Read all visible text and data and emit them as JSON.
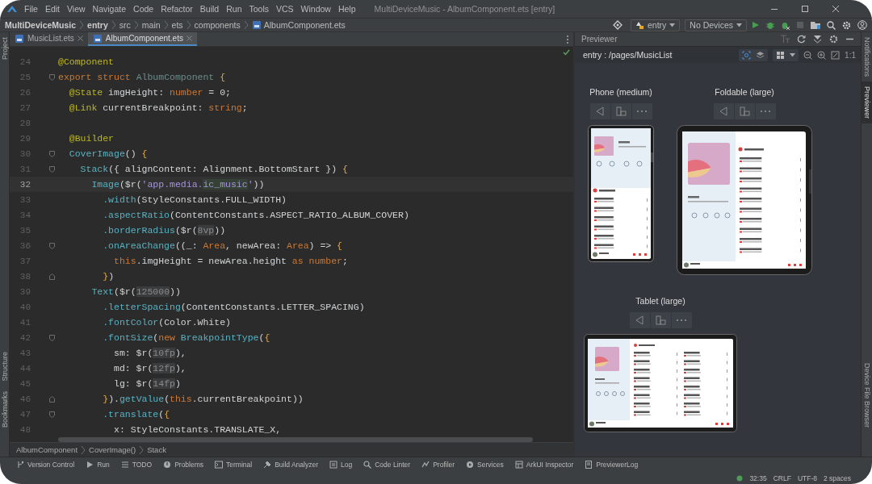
{
  "menu": [
    "File",
    "Edit",
    "View",
    "Navigate",
    "Code",
    "Refactor",
    "Build",
    "Run",
    "Tools",
    "VCS",
    "Window",
    "Help"
  ],
  "window_title": "MultiDeviceMusic - AlbumComponent.ets [entry]",
  "breadcrumbs": [
    {
      "label": "MultiDeviceMusic",
      "kind": "project"
    },
    {
      "label": "entry",
      "kind": "module"
    },
    {
      "label": "src",
      "kind": "folder"
    },
    {
      "label": "main",
      "kind": "folder"
    },
    {
      "label": "ets",
      "kind": "folder"
    },
    {
      "label": "components",
      "kind": "folder"
    },
    {
      "label": "AlbumComponent.ets",
      "kind": "file"
    }
  ],
  "run_config": "entry",
  "device_selector": "No Devices",
  "left_tool_tabs": {
    "top": [
      {
        "label": "Project"
      }
    ],
    "bottom": [
      {
        "label": "Structure"
      },
      {
        "label": "Bookmarks"
      }
    ]
  },
  "right_tool_tabs": {
    "top": [
      {
        "label": "Notifications",
        "selected": false
      },
      {
        "label": "Previewer",
        "selected": true
      }
    ],
    "bottom": [
      {
        "label": "Device File Browser",
        "selected": false
      }
    ]
  },
  "editor": {
    "tabs": [
      {
        "label": "MusicList.ets",
        "selected": false
      },
      {
        "label": "AlbumComponent.ets",
        "selected": true
      }
    ],
    "lines": [
      {
        "number": "24",
        "current": false,
        "kind": "plain",
        "tokens": [
          {
            "kind": "annotation",
            "t": "@Component"
          }
        ]
      },
      {
        "number": "25",
        "current": false,
        "kind": "fold_start",
        "tokens": [
          {
            "kind": "keyword",
            "t": "export struct "
          },
          {
            "kind": "type",
            "t": "AlbumComponent"
          },
          {
            "kind": "brace",
            "t": " {"
          }
        ]
      },
      {
        "number": "26",
        "current": false,
        "kind": "plain",
        "tokens": [
          {
            "kind": "annotation",
            "t": "  @State"
          },
          {
            "kind": "plain",
            "t": " imgHeight: "
          },
          {
            "kind": "keyword",
            "t": "number"
          },
          {
            "kind": "plain",
            "t": " = 0;"
          }
        ]
      },
      {
        "number": "27",
        "current": false,
        "kind": "plain",
        "tokens": [
          {
            "kind": "annotation",
            "t": "  @Link"
          },
          {
            "kind": "plain",
            "t": " currentBreakpoint: "
          },
          {
            "kind": "keyword",
            "t": "string"
          },
          {
            "kind": "plain",
            "t": ";"
          }
        ]
      },
      {
        "number": "28",
        "current": false,
        "kind": "plain"
      },
      {
        "number": "29",
        "current": false,
        "kind": "plain",
        "tokens": [
          {
            "kind": "annotation",
            "t": "  @Builder"
          }
        ]
      },
      {
        "number": "30",
        "current": false,
        "kind": "fold_start",
        "tokens": [
          {
            "kind": "function",
            "t": "  CoverImage"
          },
          {
            "kind": "plain",
            "t": "() "
          },
          {
            "kind": "brace",
            "t": "{"
          }
        ]
      },
      {
        "number": "31",
        "current": false,
        "kind": "fold_start",
        "tokens": [
          {
            "kind": "function",
            "t": "    Stack"
          },
          {
            "kind": "plain",
            "t": "({ alignContent: Alignment.BottomStart }) "
          },
          {
            "kind": "brace",
            "t": "{"
          }
        ]
      },
      {
        "number": "32",
        "current": true,
        "kind": "plain",
        "tokens": [
          {
            "kind": "function",
            "t": "      Image"
          },
          {
            "kind": "plain",
            "t": "($r("
          },
          {
            "kind": "string",
            "t": "'app.media."
          },
          {
            "kind": "match",
            "t": "ic_music"
          },
          {
            "kind": "string",
            "t": "'"
          },
          {
            "kind": "plain",
            "t": "))"
          }
        ]
      },
      {
        "number": "33",
        "current": false,
        "kind": "plain",
        "tokens": [
          {
            "kind": "function",
            "t": "        .width"
          },
          {
            "kind": "plain",
            "t": "(StyleConstants.FULL_WIDTH)"
          }
        ]
      },
      {
        "number": "34",
        "current": false,
        "kind": "plain",
        "tokens": [
          {
            "kind": "function",
            "t": "        .aspectRatio"
          },
          {
            "kind": "plain",
            "t": "(ContentConstants.ASPECT_RATIO_ALBUM_COVER)"
          }
        ]
      },
      {
        "number": "35",
        "current": false,
        "kind": "plain",
        "tokens": [
          {
            "kind": "function",
            "t": "        .borderRadius"
          },
          {
            "kind": "plain",
            "t": "($r("
          },
          {
            "kind": "resource",
            "t": "8vp"
          },
          {
            "kind": "plain",
            "t": "))"
          }
        ]
      },
      {
        "number": "36",
        "current": false,
        "kind": "fold_start",
        "tokens": [
          {
            "kind": "function",
            "t": "        .onAreaChange"
          },
          {
            "kind": "plain",
            "t": "((_: "
          },
          {
            "kind": "keyword",
            "t": "Area"
          },
          {
            "kind": "plain",
            "t": ", newArea: "
          },
          {
            "kind": "keyword",
            "t": "Area"
          },
          {
            "kind": "plain",
            "t": ") => "
          },
          {
            "kind": "brace",
            "t": "{"
          }
        ]
      },
      {
        "number": "37",
        "current": false,
        "kind": "plain",
        "tokens": [
          {
            "kind": "keyword",
            "t": "          this"
          },
          {
            "kind": "plain",
            "t": ".imgHeight = newArea.height "
          },
          {
            "kind": "keyword",
            "t": "as number"
          },
          {
            "kind": "plain",
            "t": ";"
          }
        ]
      },
      {
        "number": "38",
        "current": false,
        "kind": "fold_end",
        "tokens": [
          {
            "kind": "brace",
            "t": "        }"
          },
          {
            "kind": "plain",
            "t": ")"
          }
        ]
      },
      {
        "number": "39",
        "current": false,
        "kind": "plain",
        "tokens": [
          {
            "kind": "function",
            "t": "      Text"
          },
          {
            "kind": "plain",
            "t": "($r("
          },
          {
            "kind": "resource",
            "t": "125000"
          },
          {
            "kind": "plain",
            "t": "))"
          }
        ]
      },
      {
        "number": "40",
        "current": false,
        "kind": "plain",
        "tokens": [
          {
            "kind": "function",
            "t": "        .letterSpacing"
          },
          {
            "kind": "plain",
            "t": "(ContentConstants.LETTER_SPACING)"
          }
        ]
      },
      {
        "number": "41",
        "current": false,
        "kind": "plain",
        "tokens": [
          {
            "kind": "function",
            "t": "        .fontColor"
          },
          {
            "kind": "plain",
            "t": "(Color.White)"
          }
        ]
      },
      {
        "number": "42",
        "current": false,
        "kind": "fold_start",
        "tokens": [
          {
            "kind": "function",
            "t": "        .fontSize"
          },
          {
            "kind": "plain",
            "t": "("
          },
          {
            "kind": "keyword",
            "t": "new "
          },
          {
            "kind": "function",
            "t": "BreakpointType"
          },
          {
            "kind": "plain",
            "t": "("
          },
          {
            "kind": "brace",
            "t": "{"
          }
        ]
      },
      {
        "number": "43",
        "current": false,
        "kind": "plain",
        "tokens": [
          {
            "kind": "plain",
            "t": "          sm: $r("
          },
          {
            "kind": "resource",
            "t": "10fp"
          },
          {
            "kind": "plain",
            "t": "),"
          }
        ]
      },
      {
        "number": "44",
        "current": false,
        "kind": "plain",
        "tokens": [
          {
            "kind": "plain",
            "t": "          md: $r("
          },
          {
            "kind": "resource",
            "t": "12fp"
          },
          {
            "kind": "plain",
            "t": "),"
          }
        ]
      },
      {
        "number": "45",
        "current": false,
        "kind": "plain",
        "tokens": [
          {
            "kind": "plain",
            "t": "          lg: $r("
          },
          {
            "kind": "resource",
            "t": "14fp"
          },
          {
            "kind": "plain",
            "t": ")"
          }
        ]
      },
      {
        "number": "46",
        "current": false,
        "kind": "fold_end",
        "tokens": [
          {
            "kind": "brace",
            "t": "        }"
          },
          {
            "kind": "plain",
            "t": ")."
          },
          {
            "kind": "function",
            "t": "getValue"
          },
          {
            "kind": "plain",
            "t": "("
          },
          {
            "kind": "keyword",
            "t": "this"
          },
          {
            "kind": "plain",
            "t": ".currentBreakpoint))"
          }
        ]
      },
      {
        "number": "47",
        "current": false,
        "kind": "fold_start",
        "tokens": [
          {
            "kind": "function",
            "t": "        .translate"
          },
          {
            "kind": "plain",
            "t": "("
          },
          {
            "kind": "brace",
            "t": "{"
          }
        ]
      },
      {
        "number": "48",
        "current": false,
        "kind": "plain",
        "tokens": [
          {
            "kind": "plain",
            "t": "          x: StyleConstants.TRANSLATE_X,"
          }
        ]
      }
    ],
    "breadcrumb": [
      "AlbumComponent",
      "CoverImage()",
      "Stack"
    ]
  },
  "previewer": {
    "title": "Previewer",
    "path": "entry : /pages/MusicList",
    "zoom_label": "1:1",
    "devices": [
      {
        "name": "Phone (medium)",
        "kind": "phone"
      },
      {
        "name": "Foldable (large)",
        "kind": "foldable"
      },
      {
        "name": "Tablet (large)",
        "kind": "tablet"
      }
    ]
  },
  "tool_windows": [
    {
      "label": "Version Control",
      "kind": "vcs"
    },
    {
      "label": "Run",
      "kind": "run"
    },
    {
      "label": "TODO",
      "kind": "list"
    },
    {
      "label": "Problems",
      "kind": "info"
    },
    {
      "label": "Terminal",
      "kind": "terminal"
    },
    {
      "label": "Build Analyzer",
      "kind": "build"
    },
    {
      "label": "Log",
      "kind": "log"
    },
    {
      "label": "Code Linter",
      "kind": "search"
    },
    {
      "label": "Profiler",
      "kind": "profiler"
    },
    {
      "label": "Services",
      "kind": "services"
    },
    {
      "label": "ArkUI Inspector",
      "kind": "inspector"
    },
    {
      "label": "PreviewerLog",
      "kind": "doc"
    }
  ],
  "status_bar": [
    "32:35",
    "CRLF",
    "UTF-8",
    "2 spaces"
  ]
}
